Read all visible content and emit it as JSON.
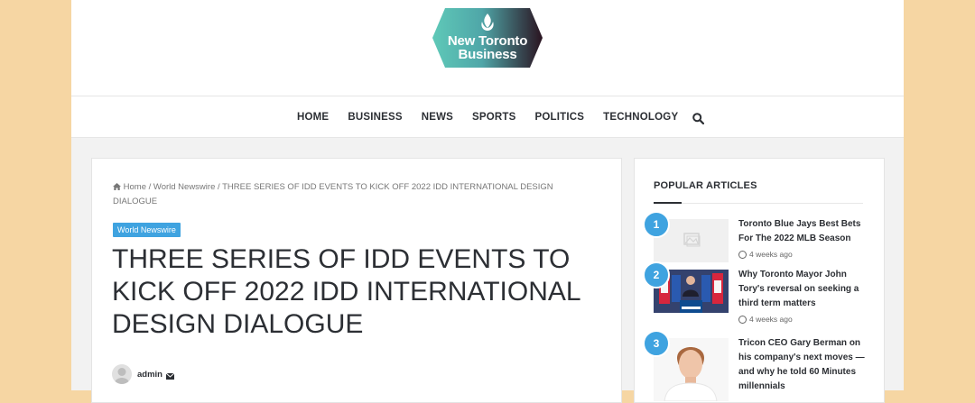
{
  "site": {
    "logo_line1": "New Toronto",
    "logo_line2": "Business"
  },
  "nav": {
    "items": [
      "HOME",
      "BUSINESS",
      "NEWS",
      "SPORTS",
      "POLITICS",
      "TECHNOLOGY"
    ],
    "search_icon": "search-icon"
  },
  "breadcrumb": {
    "home": "Home",
    "sep1": " / ",
    "section": "World Newswire",
    "sep2": " / ",
    "current": "THREE SERIES OF IDD EVENTS TO KICK OFF 2022 IDD INTERNATIONAL DESIGN DIALOGUE"
  },
  "article": {
    "category": "World Newswire",
    "title": "THREE SERIES OF IDD EVENTS TO KICK OFF 2022 IDD INTERNATIONAL DESIGN DIALOGUE",
    "author": "admin"
  },
  "sidebar": {
    "title": "POPULAR ARTICLES",
    "items": [
      {
        "num": "1",
        "title": "Toronto Blue Jays Best Bets For The 2022 MLB Season",
        "date": "4 weeks ago"
      },
      {
        "num": "2",
        "title": "Why Toronto Mayor John Tory's reversal on seeking a third term matters",
        "date": "4 weeks ago"
      },
      {
        "num": "3",
        "title": "Tricon CEO Gary Berman on his company's next moves — and why he told 60 Minutes millennials",
        "date": ""
      }
    ]
  },
  "colors": {
    "accent": "#3fa3e0",
    "page_bg": "#f6d6a3"
  }
}
